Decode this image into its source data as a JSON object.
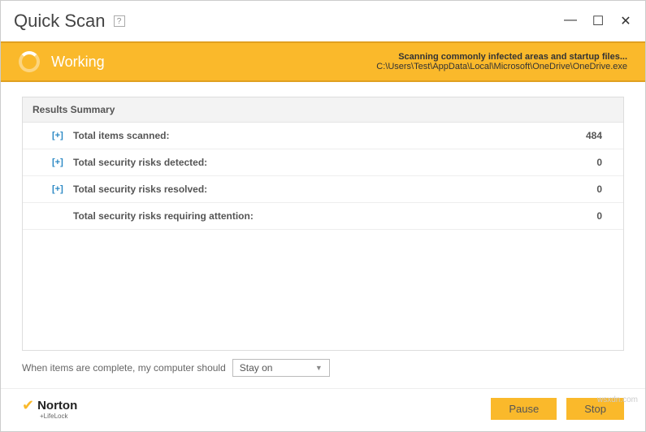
{
  "title": "Quick Scan",
  "help": "?",
  "controls": {
    "min": "—",
    "max": "☐",
    "close": "✕"
  },
  "status": {
    "label": "Working",
    "heading": "Scanning commonly infected areas and startup files...",
    "path": "C:\\Users\\Test\\AppData\\Local\\Microsoft\\OneDrive\\OneDrive.exe"
  },
  "results": {
    "header": "Results Summary",
    "rows": [
      {
        "expand": "[+]",
        "label": "Total items scanned:",
        "value": "484"
      },
      {
        "expand": "[+]",
        "label": "Total security risks detected:",
        "value": "0"
      },
      {
        "expand": "[+]",
        "label": "Total security risks resolved:",
        "value": "0"
      },
      {
        "expand": "",
        "label": "Total security risks requiring attention:",
        "value": "0"
      }
    ]
  },
  "afterAction": {
    "label": "When items are complete, my computer should",
    "selected": "Stay on"
  },
  "logo": {
    "name": "Norton",
    "sub": "+LifeLock"
  },
  "buttons": {
    "pause": "Pause",
    "stop": "Stop"
  },
  "watermark": "wsxdn.com"
}
